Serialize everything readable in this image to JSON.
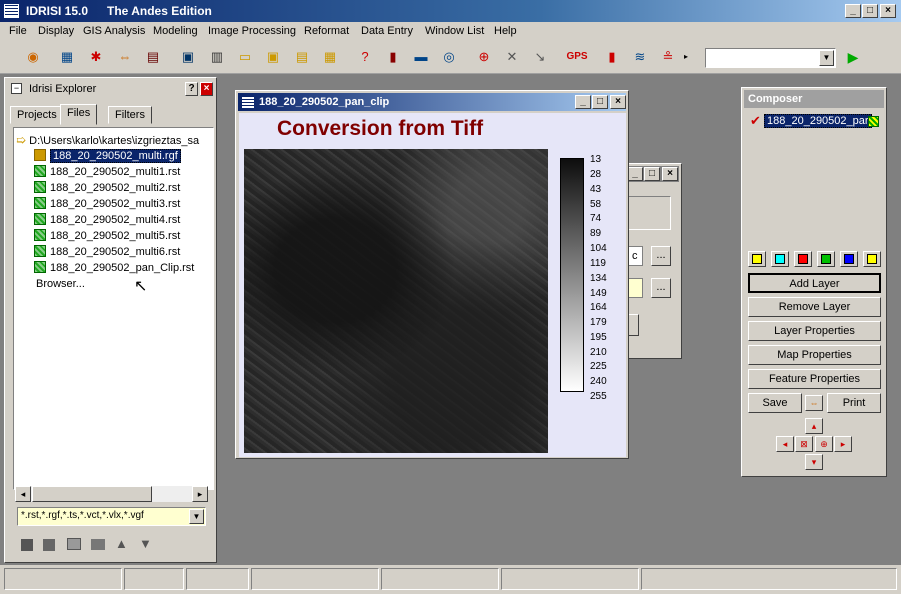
{
  "app": {
    "title": "IDRISI 15.0",
    "edition": "The Andes Edition"
  },
  "menu": [
    "File",
    "Display",
    "GIS Analysis",
    "Modeling",
    "Image Processing",
    "Reformat",
    "Data Entry",
    "Window List",
    "Help"
  ],
  "toolbar": {
    "gps_label": "GPS",
    "combo_value": ""
  },
  "explorer": {
    "title": "Idrisi Explorer",
    "help_glyph": "?",
    "tabs": [
      "Projects",
      "Files",
      "Filters"
    ],
    "path": "D:\\Users\\karlo\\kartes\\izgrieztas_sa",
    "files": [
      "188_20_290502_multi.rgf",
      "188_20_290502_multi1.rst",
      "188_20_290502_multi2.rst",
      "188_20_290502_multi3.rst",
      "188_20_290502_multi4.rst",
      "188_20_290502_multi5.rst",
      "188_20_290502_multi6.rst",
      "188_20_290502_pan_Clip.rst"
    ],
    "browser": "Browser...",
    "filter": "*.rst,*.rgf,*.ts,*.vct,*.vlx,*.vgf"
  },
  "image_window": {
    "title": "188_20_290502_pan_clip",
    "heading": "Conversion from Tiff",
    "legend": [
      "13",
      "28",
      "43",
      "58",
      "74",
      "89",
      "104",
      "119",
      "134",
      "149",
      "164",
      "179",
      "195",
      "210",
      "225",
      "240",
      "255"
    ]
  },
  "dialog": {
    "browse": "...",
    "partial_text": "c"
  },
  "composer": {
    "title": "Composer",
    "layer": "188_20_290502_par",
    "buttons": [
      "Add Layer",
      "Remove Layer",
      "Layer Properties",
      "Map Properties",
      "Feature Properties"
    ],
    "save": "Save",
    "print": "Print",
    "swatch_colors": [
      "#ffff00",
      "#00ffff",
      "#ff0000",
      "#00c000",
      "#0000ff",
      "#ffff00"
    ]
  }
}
